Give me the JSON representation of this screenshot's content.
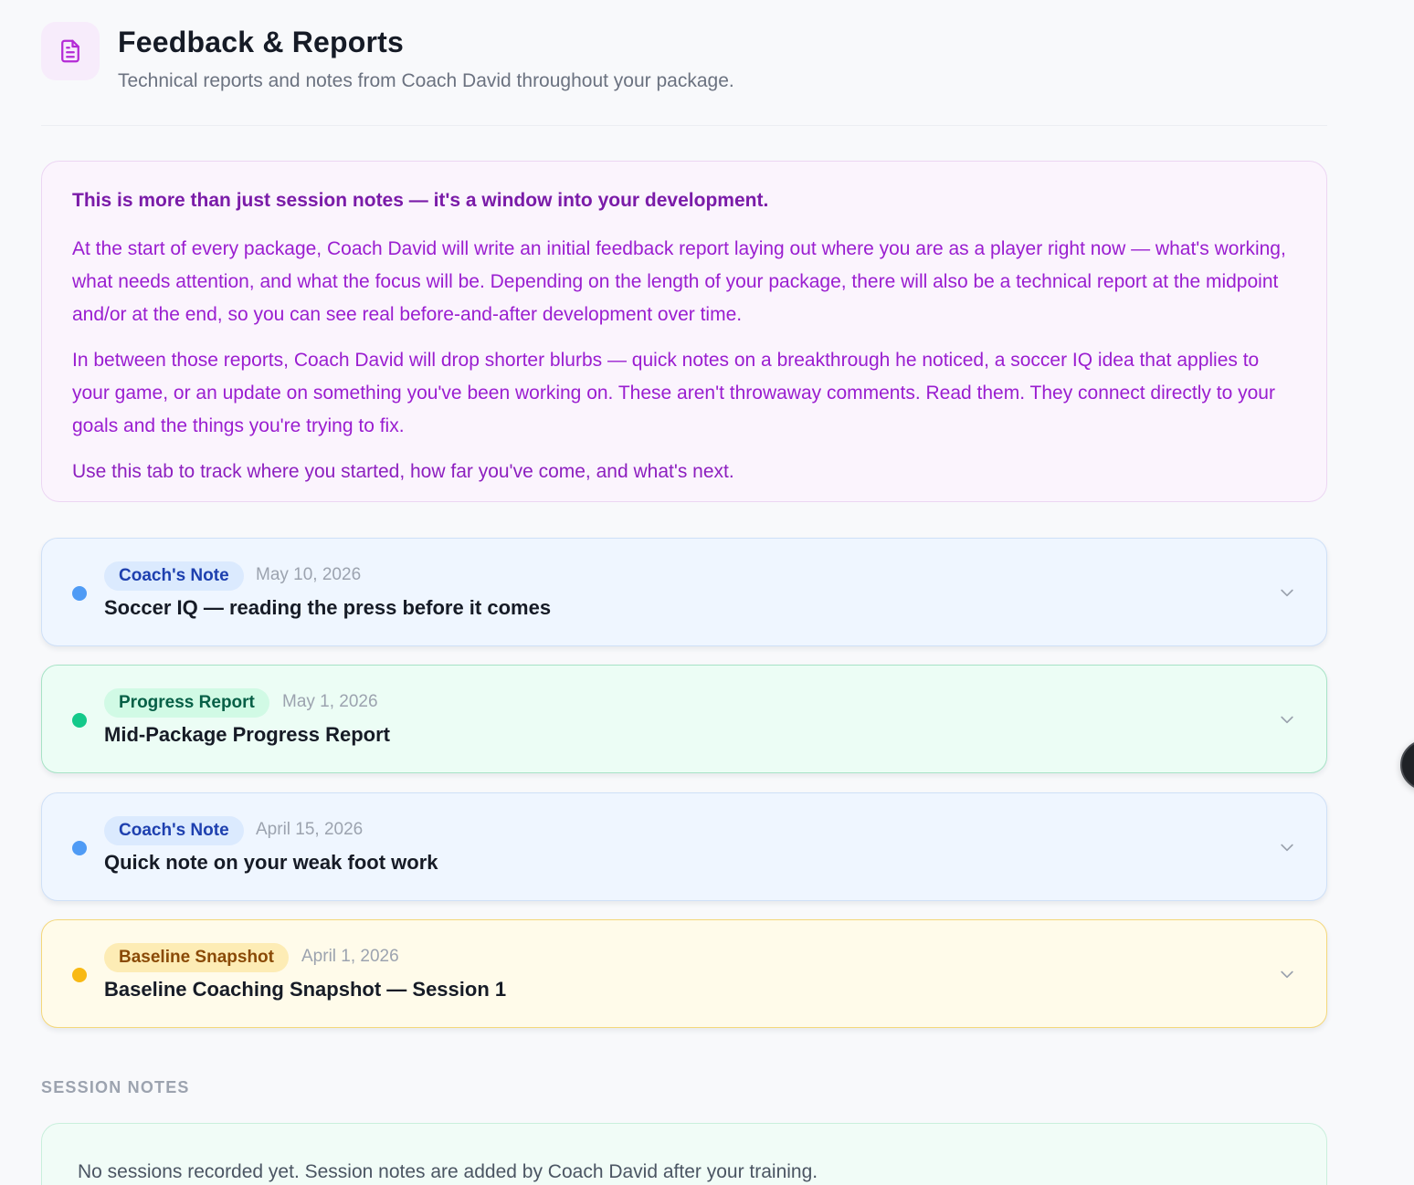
{
  "header": {
    "icon": "document-icon",
    "title": "Feedback & Reports",
    "subtitle": "Technical reports and notes from Coach David throughout your package."
  },
  "intro": {
    "heading": "This is more than just session notes — it's a window into your development.",
    "paragraphs": [
      "At the start of every package, Coach David will write an initial feedback report laying out where you are as a player right now — what's working, what needs attention, and what the focus will be. Depending on the length of your package, there will also be a technical report at the midpoint and/or at the end, so you can see real before-and-after development over time.",
      "In between those reports, Coach David will drop shorter blurbs — quick notes on a breakthrough he noticed, a soccer IQ idea that applies to your game, or an update on something you've been working on. These aren't throwaway comments. Read them. They connect directly to your goals and the things you're trying to fix.",
      "Use this tab to track where you started, how far you've come, and what's next."
    ]
  },
  "entries": [
    {
      "badge": "Coach's Note",
      "date": "May 10, 2026",
      "title": "Soccer IQ — reading the press before it comes",
      "color": "#4f9bf5"
    },
    {
      "badge": "Progress Report",
      "date": "May 1, 2026",
      "title": "Mid-Package Progress Report",
      "color": "#14c98a"
    },
    {
      "badge": "Coach's Note",
      "date": "April 15, 2026",
      "title": "Quick note on your weak foot work",
      "color": "#4f9bf5"
    },
    {
      "badge": "Baseline Snapshot",
      "date": "April 1, 2026",
      "title": "Baseline Coaching Snapshot — Session 1",
      "color": "#f8b914"
    }
  ],
  "session_notes": {
    "label": "SESSION NOTES",
    "empty_text": "No sessions recorded yet. Session notes are added by Coach David after your training."
  },
  "colors": {
    "accent_purple": "#9a1ed0",
    "note_blue": "#4f9bf5",
    "progress_green": "#14c98a",
    "baseline_yellow": "#f8b914"
  }
}
